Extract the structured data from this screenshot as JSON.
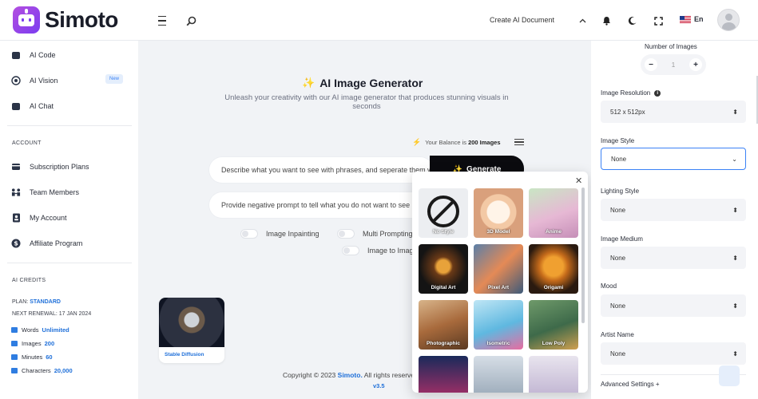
{
  "header": {
    "brand": "Simoto",
    "create_doc": "Create AI Document",
    "language": "En"
  },
  "sidebar": {
    "items_top": [
      {
        "label": "AI Code",
        "icon": "code-icon"
      },
      {
        "label": "AI Vision",
        "icon": "vision-icon"
      },
      {
        "label": "AI Chat",
        "icon": "chat-icon"
      }
    ],
    "new_badge": "New",
    "account_heading": "ACCOUNT",
    "account_items": [
      {
        "label": "Subscription Plans",
        "icon": "subscription-icon"
      },
      {
        "label": "Team Members",
        "icon": "team-icon"
      },
      {
        "label": "My Account",
        "icon": "account-icon"
      },
      {
        "label": "Affiliate Program",
        "icon": "dollar-icon"
      }
    ],
    "credits_heading": "AI CREDITS",
    "plan_label": "PLAN:",
    "plan_value": "STANDARD",
    "renewal": "NEXT RENEWAL: 17 JAN 2024",
    "credits": [
      {
        "label": "Words",
        "value": "Unlimited"
      },
      {
        "label": "Images",
        "value": "200"
      },
      {
        "label": "Minutes",
        "value": "60"
      },
      {
        "label": "Characters",
        "value": "20,000"
      }
    ]
  },
  "main": {
    "title": "AI Image Generator",
    "subtitle": "Unleash your creativity with our AI image generator that produces stunning visuals in seconds",
    "balance_label": "Your Balance is",
    "balance_value": "200 Images",
    "prompt_placeholder": "Describe what you want to see with phrases, and seperate them with commas",
    "negative_placeholder": "Provide negative prompt to tell what you do not want to see",
    "generate_label": "Generate",
    "toggles": [
      "Image Inpainting",
      "Multi Prompting",
      "Image to Image"
    ],
    "model_card": "Stable Diffusion",
    "footer_text": "Copyright © 2023",
    "footer_brand": "Simoto.",
    "footer_rest": "All rights reserved",
    "version": "v3.5"
  },
  "styles_popup": {
    "tiles": [
      "No Style",
      "3D Model",
      "Anime",
      "Digital Art",
      "Pixel Art",
      "Origami",
      "Photographic",
      "Isometric",
      "Low Poly",
      "",
      "",
      ""
    ]
  },
  "right_panel": {
    "number_label": "Number of Images",
    "number_value": "1",
    "resolution_label": "Image Resolution",
    "resolution_value": "512 x 512px",
    "style_label": "Image Style",
    "style_value": "None",
    "lighting_label": "Lighting Style",
    "lighting_value": "None",
    "medium_label": "Image Medium",
    "medium_value": "None",
    "mood_label": "Mood",
    "mood_value": "None",
    "artist_label": "Artist Name",
    "artist_value": "None",
    "advanced_label": "Advanced Settings +"
  }
}
